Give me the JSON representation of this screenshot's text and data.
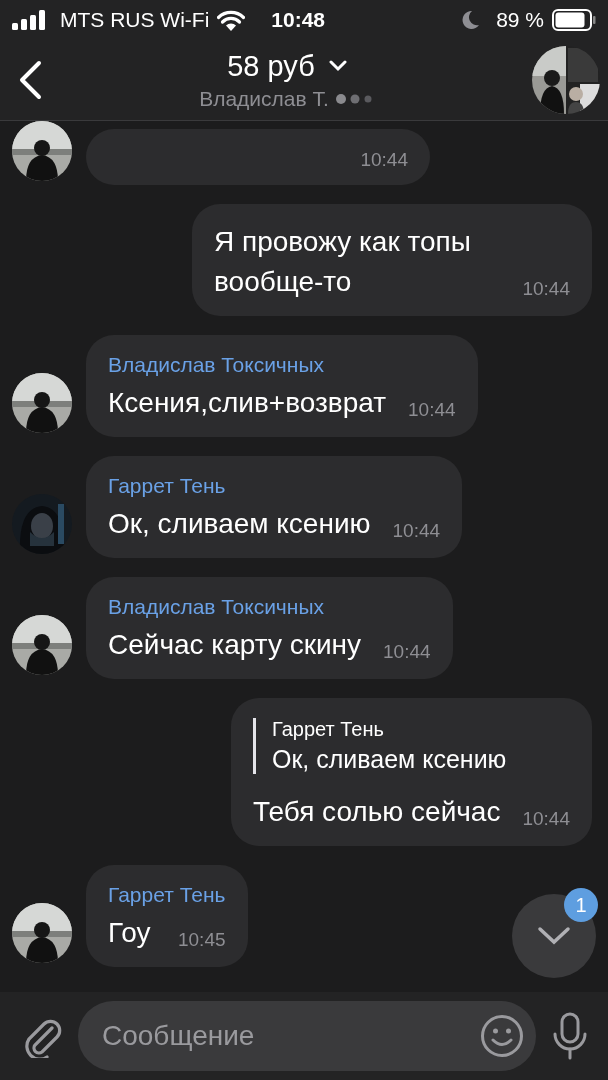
{
  "status_bar": {
    "carrier": "MTS RUS Wi-Fi",
    "time": "10:48",
    "battery": "89 %"
  },
  "header": {
    "title": "58 руб",
    "subtitle": "Владислав Т."
  },
  "messages": [
    {
      "kind": "incoming",
      "time": "10:44"
    },
    {
      "kind": "outgoing",
      "text": "Я провожу как топы вообще-то",
      "time": "10:44"
    },
    {
      "kind": "incoming",
      "sender": "Владислав Токсичных",
      "text": "Ксения,слив+возврат",
      "time": "10:44"
    },
    {
      "kind": "incoming",
      "sender": "Гаррет Тень",
      "text": "Ок, сливаем ксению",
      "time": "10:44"
    },
    {
      "kind": "incoming",
      "sender": "Владислав Токсичных",
      "text": "Сейчас карту скину",
      "time": "10:44"
    },
    {
      "kind": "outgoing",
      "reply": {
        "sender": "Гаррет Тень",
        "text": "Ок, сливаем ксению"
      },
      "text": "Тебя солью сейчас",
      "time": "10:44"
    },
    {
      "kind": "incoming",
      "sender": "Гаррет Тень",
      "text": "Гоу",
      "time": "10:45"
    }
  ],
  "scroll_button": {
    "badge": "1"
  },
  "composer": {
    "placeholder": "Сообщение"
  }
}
